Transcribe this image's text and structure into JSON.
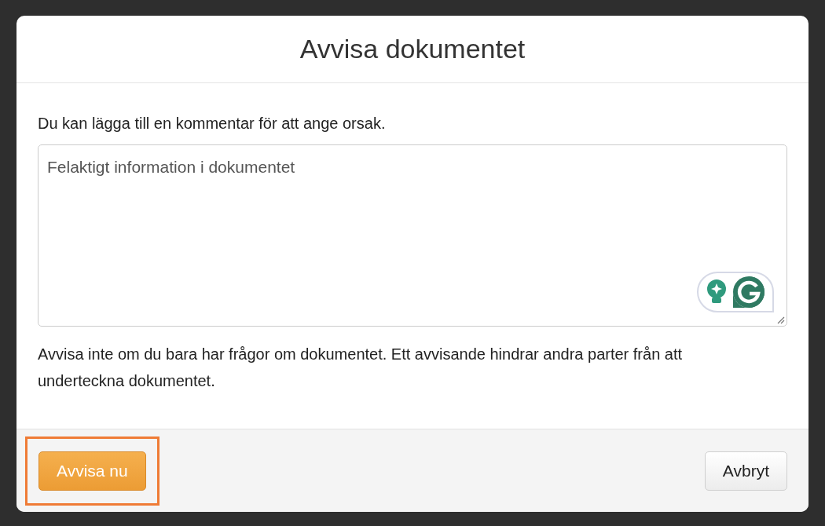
{
  "dialog": {
    "title": "Avvisa dokumentet",
    "prompt": "Du kan lägga till en kommentar för att ange orsak.",
    "comment": {
      "value": "Felaktigt information i dokumentet"
    },
    "warning": "Avvisa inte om du bara har frågor om dokumentet. Ett avvisande hindrar andra parter från att underteckna dokumentet.",
    "buttons": [
      {
        "kind": "primary",
        "label": "Avvisa nu",
        "highlighted": true
      },
      {
        "kind": "secondary",
        "label": "Avbryt",
        "highlighted": false
      }
    ]
  }
}
